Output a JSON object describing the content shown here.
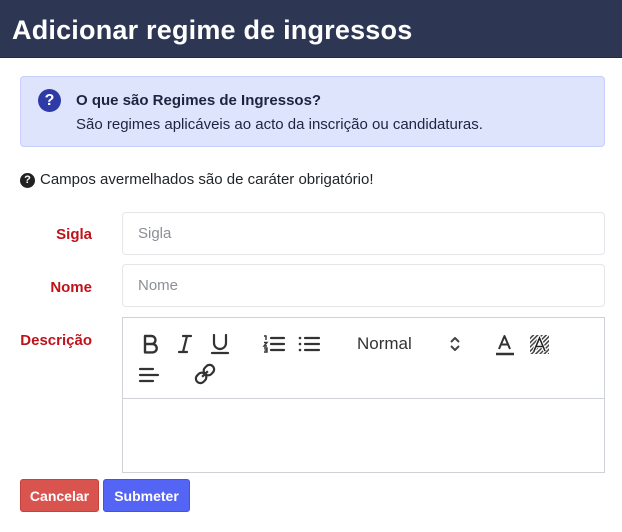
{
  "modal": {
    "title": "Adicionar regime de ingressos"
  },
  "info": {
    "icon": "question-circle-icon",
    "title": "O que são Regimes de Ingressos?",
    "text": "São regimes aplicáveis ao acto da inscrição ou candidaturas."
  },
  "required_note": "Campos avermelhados são de caráter obrigatório!",
  "form": {
    "sigla": {
      "label": "Sigla",
      "placeholder": "Sigla",
      "value": ""
    },
    "nome": {
      "label": "Nome",
      "placeholder": "Nome",
      "value": ""
    },
    "descricao": {
      "label": "Descrição",
      "value": ""
    }
  },
  "editor_toolbar": {
    "header_select": "Normal",
    "buttons": [
      "bold-icon",
      "italic-icon",
      "underline-icon",
      "ordered-list-icon",
      "bullet-list-icon",
      "text-color-icon",
      "background-color-icon",
      "align-icon",
      "link-icon"
    ]
  },
  "buttons": {
    "cancel": "Cancelar",
    "submit": "Submeter"
  },
  "colors": {
    "header_bg": "#2d3754",
    "info_bg": "#dfe4fd",
    "required_label": "#c0121a",
    "cancel_bg": "#d9534f",
    "submit_bg": "#5464f5"
  }
}
